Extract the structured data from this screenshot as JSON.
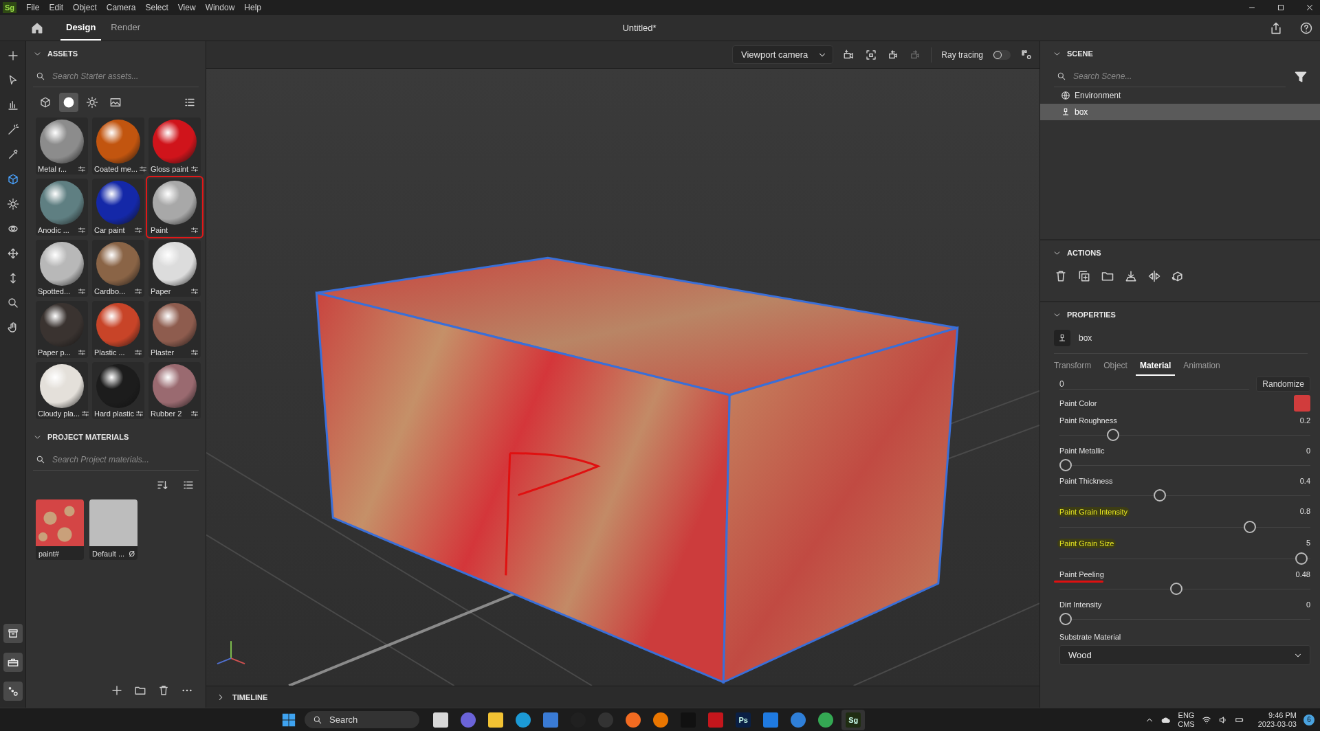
{
  "app_logo": "Sg",
  "menu": [
    "File",
    "Edit",
    "Object",
    "Camera",
    "Select",
    "View",
    "Window",
    "Help"
  ],
  "window": {
    "title": "Untitled*"
  },
  "tabs": [
    {
      "label": "Design",
      "selected": true
    },
    {
      "label": "Render",
      "selected": false
    }
  ],
  "tools": [
    {
      "kind": "plus",
      "selected": false
    },
    {
      "kind": "cursor",
      "selected": false
    },
    {
      "kind": "chart",
      "selected": false
    },
    {
      "kind": "wand",
      "selected": false
    },
    {
      "kind": "eyedropper",
      "selected": false
    },
    {
      "kind": "cube",
      "selected": true
    },
    {
      "kind": "sun",
      "selected": false
    },
    {
      "kind": "orbit",
      "selected": false
    },
    {
      "kind": "move",
      "selected": false
    },
    {
      "kind": "updown",
      "selected": false
    },
    {
      "kind": "search",
      "selected": false
    },
    {
      "kind": "hand",
      "selected": false
    }
  ],
  "bottom_tools": [
    {
      "kind": "archive"
    },
    {
      "kind": "toolbox"
    },
    {
      "kind": "nodes"
    }
  ],
  "assets": {
    "title": "ASSETS",
    "placeholder": "Search Starter assets...",
    "filters": [
      {
        "kind": "cube",
        "selected": false
      },
      {
        "kind": "sphere",
        "selected": true
      },
      {
        "kind": "sun",
        "selected": false
      },
      {
        "kind": "image",
        "selected": false
      }
    ],
    "materials": [
      {
        "name": "Metal r...",
        "color": "#8c8c8c",
        "circled": false
      },
      {
        "name": "Coated me...",
        "color": "#c2550f",
        "circled": false
      },
      {
        "name": "Gloss paint",
        "color": "#d0141b",
        "circled": false
      },
      {
        "name": "Anodic ...",
        "color": "#5f7f82",
        "circled": false
      },
      {
        "name": "Car paint",
        "color": "#1428a8",
        "circled": false
      },
      {
        "name": "Paint",
        "color": "#a8a8a8",
        "circled": true
      },
      {
        "name": "Spotted...",
        "color": "#b8b8b8",
        "circled": false
      },
      {
        "name": "Cardbo...",
        "color": "#8a6446",
        "circled": false
      },
      {
        "name": "Paper",
        "color": "#dcdcdc",
        "circled": false
      },
      {
        "name": "Paper p...",
        "color": "#3a3330",
        "circled": false
      },
      {
        "name": "Plastic ...",
        "color": "#c84428",
        "circled": false
      },
      {
        "name": "Plaster",
        "color": "#8e5c4e",
        "circled": false
      },
      {
        "name": "Cloudy pla...",
        "color": "#e4e0da",
        "circled": false
      },
      {
        "name": "Hard plastic",
        "color": "#1c1c1c",
        "circled": false
      },
      {
        "name": "Rubber 2",
        "color": "#9a6a70",
        "circled": false
      }
    ]
  },
  "project_materials": {
    "title": "PROJECT MATERIALS",
    "placeholder": "Search Project materials...",
    "items": [
      {
        "name": "paint#",
        "kind": "pattern"
      },
      {
        "name": "Default ...",
        "kind": "plain",
        "badge": "Ø"
      }
    ]
  },
  "viewport": {
    "camera": "Viewport camera",
    "ray_tracing_label": "Ray tracing",
    "ray_tracing_on": false
  },
  "timeline": {
    "title": "TIMELINE"
  },
  "scene": {
    "title": "SCENE",
    "placeholder": "Search Scene...",
    "items": [
      {
        "name": "Environment",
        "kind": "environment",
        "selected": false
      },
      {
        "name": "box",
        "kind": "object",
        "selected": true
      }
    ]
  },
  "actions": {
    "title": "ACTIONS"
  },
  "properties": {
    "title": "PROPERTIES",
    "object": "box",
    "tabs": [
      {
        "label": "Transform",
        "selected": false
      },
      {
        "label": "Object",
        "selected": false
      },
      {
        "label": "Material",
        "selected": true
      },
      {
        "label": "Animation",
        "selected": false
      }
    ],
    "seed": {
      "value": "0",
      "button": "Randomize"
    },
    "color": {
      "label": "Paint Color",
      "color": "#d13c3c"
    },
    "sliders": [
      {
        "label": "Paint Roughness",
        "reading": "0.2",
        "level": 0.2,
        "highlighted": false,
        "underlined": false
      },
      {
        "label": "Paint Metallic",
        "reading": "0",
        "level": 0,
        "highlighted": false,
        "underlined": false
      },
      {
        "label": "Paint Thickness",
        "reading": "0.4",
        "level": 0.4,
        "highlighted": false,
        "underlined": false
      },
      {
        "label": "Paint Grain Intensity",
        "reading": "0.8",
        "level": 0.78,
        "highlighted": true,
        "underlined": false
      },
      {
        "label": "Paint Grain Size",
        "reading": "5",
        "level": 1,
        "highlighted": true,
        "underlined": false
      },
      {
        "label": "Paint Peeling",
        "reading": "0.48",
        "level": 0.47,
        "highlighted": false,
        "underlined": true
      },
      {
        "label": "Dirt Intensity",
        "reading": "0",
        "level": 0,
        "highlighted": false,
        "underlined": false
      }
    ],
    "substrate": {
      "label": "Substrate Material",
      "value": "Wood"
    }
  },
  "taskbar": {
    "search": "Search",
    "apps": [
      {
        "kind": "taskview",
        "active": false
      },
      {
        "kind": "teams",
        "active": false
      },
      {
        "kind": "folder",
        "active": false
      },
      {
        "kind": "edge",
        "active": false
      },
      {
        "kind": "store",
        "active": false
      },
      {
        "kind": "dell",
        "active": false
      },
      {
        "kind": "camera",
        "active": false
      },
      {
        "kind": "firefox",
        "active": false
      },
      {
        "kind": "blender",
        "active": false
      },
      {
        "kind": "audio",
        "active": false
      },
      {
        "kind": "acrobat",
        "active": false
      },
      {
        "kind": "photoshop",
        "label": "Ps",
        "active": false
      },
      {
        "kind": "files",
        "active": false
      },
      {
        "kind": "k",
        "active": false
      },
      {
        "kind": "chrome",
        "active": false
      },
      {
        "kind": "stager",
        "label": "Sg",
        "active": true
      }
    ],
    "lang": "ENG",
    "layout": "CMS",
    "time": "9:46 PM",
    "date": "2023-03-03",
    "notifications": "6"
  }
}
